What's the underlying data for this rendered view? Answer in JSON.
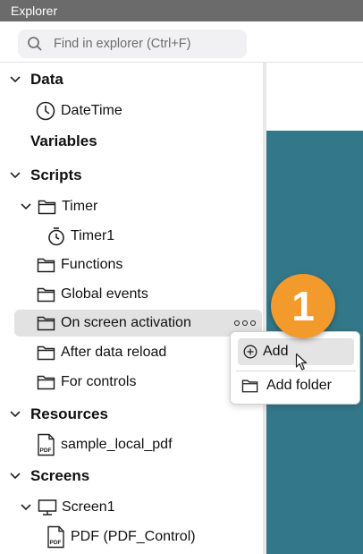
{
  "title": "Explorer",
  "search": {
    "placeholder": "Find in explorer (Ctrl+F)"
  },
  "tree": {
    "data": {
      "label": "Data",
      "children": [
        "DateTime"
      ]
    },
    "variables": {
      "label": "Variables"
    },
    "scripts": {
      "label": "Scripts",
      "timer": {
        "label": "Timer",
        "children": [
          "Timer1"
        ]
      },
      "functions": "Functions",
      "global_events": "Global events",
      "on_screen_activation": "On screen activation",
      "after_data_reload": "After data reload",
      "for_controls": "For controls"
    },
    "resources": {
      "label": "Resources",
      "children": [
        "sample_local_pdf"
      ]
    },
    "screens": {
      "label": "Screens",
      "screen1": {
        "label": "Screen1",
        "children": [
          "PDF (PDF_Control)"
        ]
      }
    }
  },
  "context_menu": {
    "add": "Add",
    "add_folder": "Add folder"
  },
  "step_badge": "1",
  "colors": {
    "titlebar": "#6b6b6b",
    "canvas": "#33788a",
    "badge": "#f39a2c",
    "selected": "#e2e2e2"
  },
  "icons": [
    "search-icon",
    "chevron-down-icon",
    "clock-icon",
    "folder-icon",
    "timer-icon",
    "pdf-file-icon",
    "monitor-icon",
    "more-icon",
    "plus-circle-icon",
    "cursor-icon"
  ]
}
